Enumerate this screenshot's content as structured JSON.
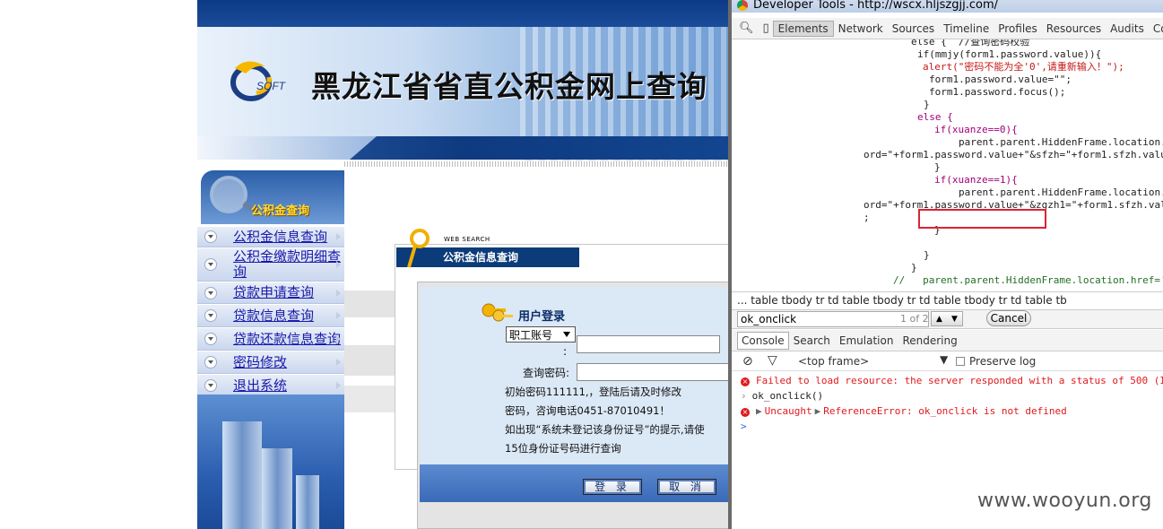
{
  "site": {
    "title": "黑龙江省省直公积金网上查询",
    "logo_text": "SOFT",
    "sidebar_header": "公积金查询",
    "menu": [
      {
        "label": "公积金信息查询"
      },
      {
        "label": "公积金缴款明细查询"
      },
      {
        "label": "贷款申请查询"
      },
      {
        "label": "贷款信息查询"
      },
      {
        "label": "贷款还款信息查询"
      },
      {
        "label": "密码修改"
      },
      {
        "label": "退出系统"
      }
    ],
    "panel_caption": "WEB SEARCH",
    "panel_title": "公积金信息查询",
    "login": {
      "title": "用户登录",
      "account_type": "职工账号",
      "account_colon": ":",
      "password_label": "查询密码:",
      "notice_lines": [
        "初始密码111111,，登陆后请及时修改",
        "密码，咨询电话0451-87010491！",
        "如出现“系统未登记该身份证号”的提示,请使",
        "15位身份证号码进行查询"
      ],
      "login_button": "登 录",
      "cancel_button": "取 消"
    }
  },
  "devtools": {
    "window_title": "Developer Tools - http://wscx.hljszgjj.com/",
    "tabs": [
      "Elements",
      "Network",
      "Sources",
      "Timeline",
      "Profiles",
      "Resources",
      "Audits",
      "Console"
    ],
    "active_tab": "Elements",
    "code_lines": [
      "else {  //查询密码校验",
      "if(mmjy(form1.password.value)){",
      "alert(\"密码不能为全'0',请重新输入！\");",
      "form1.password.value=\"\";",
      "form1.password.focus();",
      "}",
      "else {",
      "if(xuanze==0){",
      "parent.parent.HiddenFrame.location.",
      "ord=\"+form1.password.value+\"&sfzh=\"+form1.sfzh.valu",
      "}",
      "if(xuanze==1){",
      "parent.parent.HiddenFrame.location.",
      "ord=\"+form1.password.value+\"&zgzh1=\"+form1.sfzh.val",
      ";",
      "}",
      "}",
      "}",
      "//   parent.parent.HiddenFrame.location.href='"
    ],
    "breadcrumb": "...  table  tbody  tr  td  table  tbody  tr  td  table  tbody  tr  td  table  tb",
    "find_query": "ok_onclick",
    "find_count": "1 of 2",
    "cancel_label": "Cancel",
    "drawer_tabs": [
      "Console",
      "Search",
      "Emulation",
      "Rendering"
    ],
    "active_drawer_tab": "Console",
    "frame_selector": "<top frame>",
    "preserve_log": "Preserve log",
    "console": {
      "error1": "Failed to load resource: the server responded with a status of 500 (I",
      "input": "ok_onclick()",
      "error2_prefix": "Uncaught",
      "error2": "ReferenceError: ok_onclick is not defined",
      "prompt": ">"
    }
  },
  "watermark": "www.wooyun.org"
}
